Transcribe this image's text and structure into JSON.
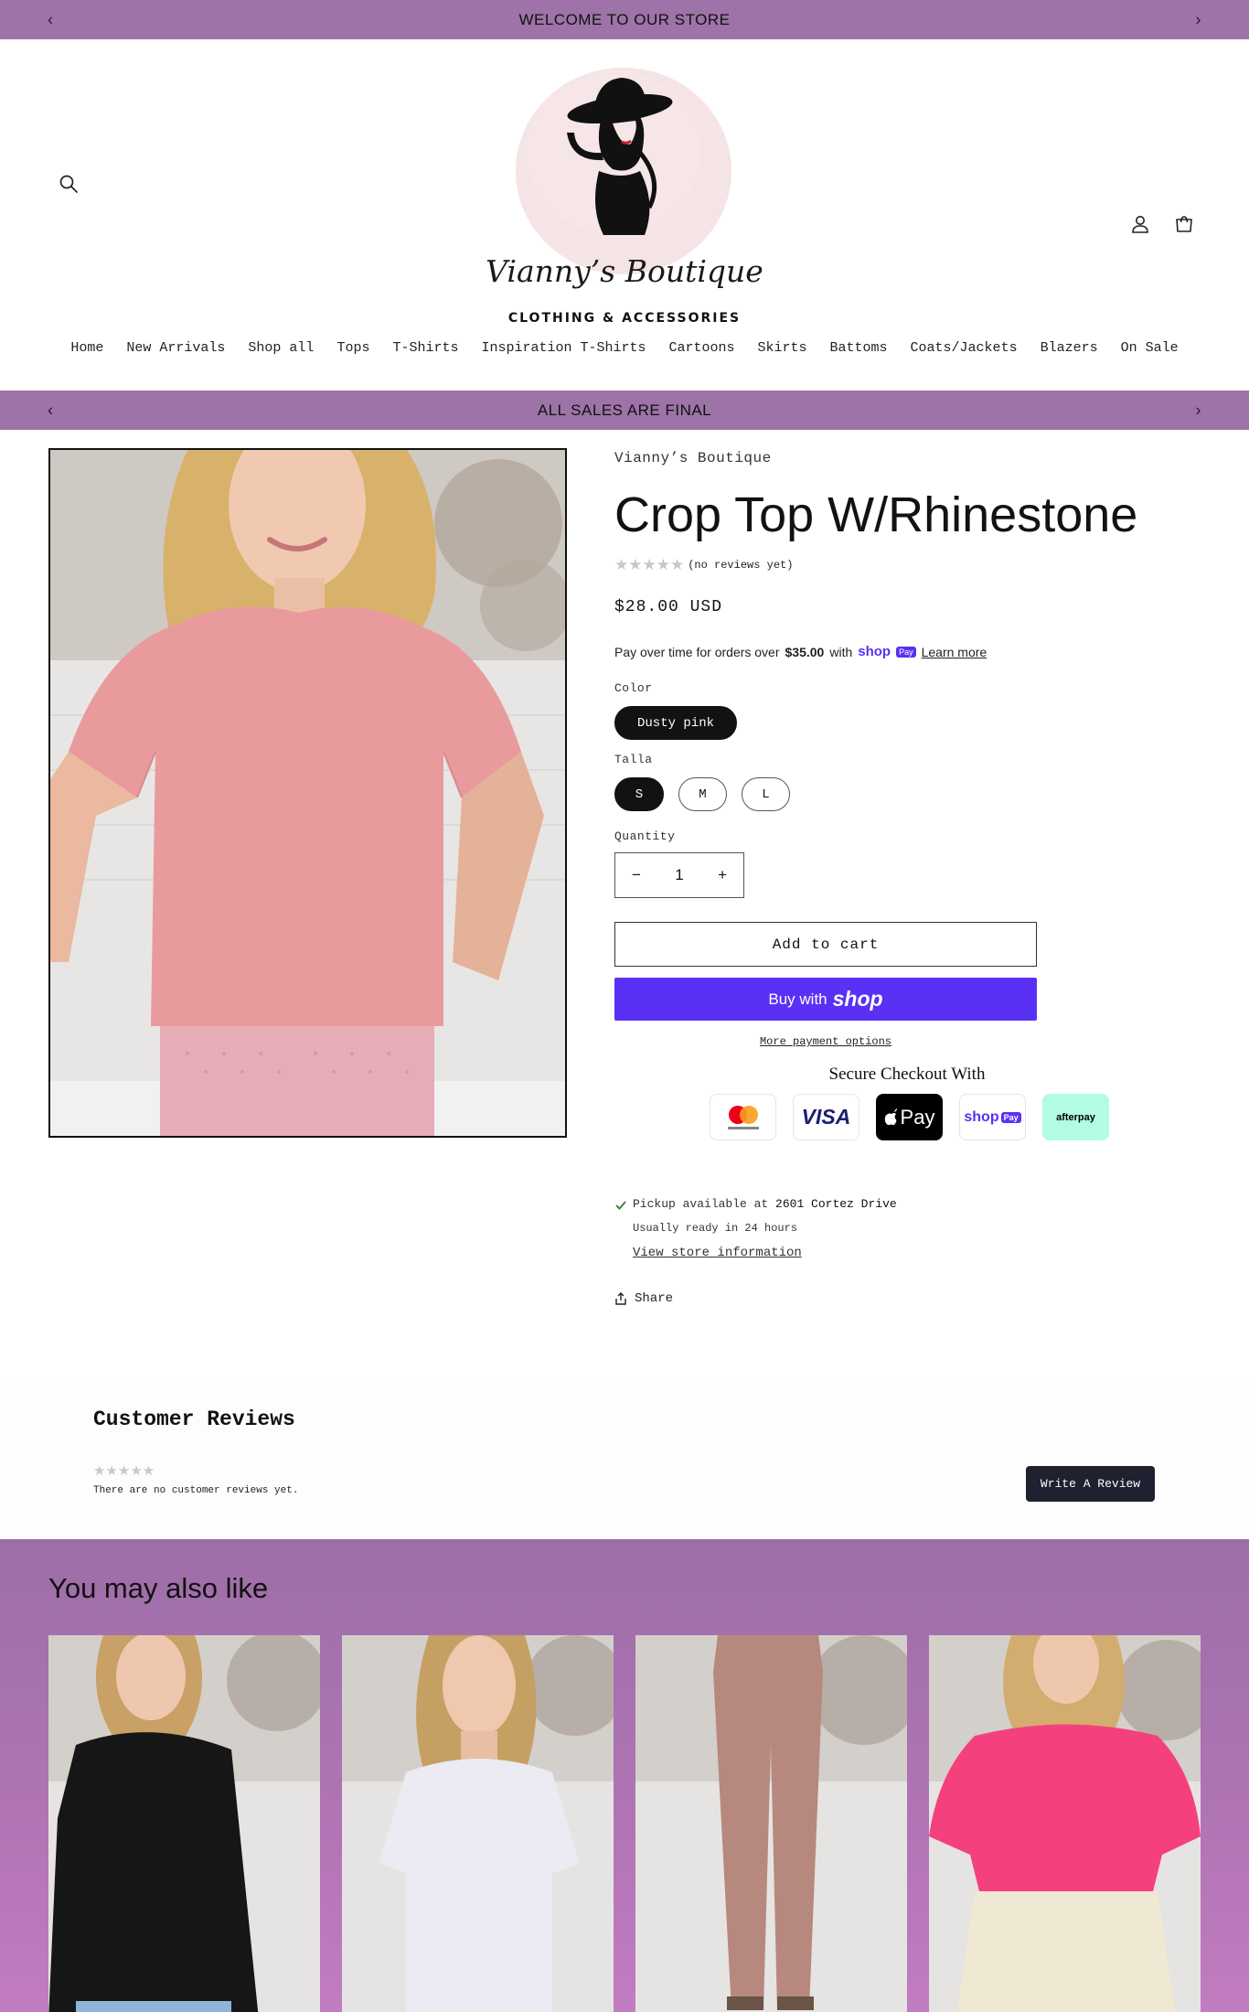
{
  "announcement_top": {
    "text": "WELCOME TO OUR STORE",
    "prev": "‹",
    "next": "›"
  },
  "announcement_second": {
    "text": "ALL SALES ARE FINAL",
    "prev": "‹",
    "next": "›"
  },
  "header": {
    "logo_title": "Vianny’s Boutique",
    "logo_subtitle": "CLOTHING & ACCESSORIES"
  },
  "nav": {
    "items": [
      "Home",
      "New Arrivals",
      "Shop all",
      "Tops",
      "T-Shirts",
      "Inspiration T-Shirts",
      "Cartoons",
      "Skirts",
      "Battoms",
      "Coats/Jackets",
      "Blazers",
      "On Sale"
    ]
  },
  "product": {
    "vendor": "Vianny’s Boutique",
    "title": "Crop Top W/Rhinestone",
    "stars": "★★★★★",
    "rating_text": "(no reviews yet)",
    "price": "$28.00 USD",
    "installments_text": "Pay over time for orders over",
    "installments_amount": "$35.00",
    "installments_with": "with",
    "installments_shop": "shop",
    "installments_pay": "Pay",
    "learn_more": "Learn more",
    "color_label": "Color",
    "color_value": "Dusty pink",
    "size_label": "Talla",
    "sizes": [
      "S",
      "M",
      "L"
    ],
    "quantity_label": "Quantity",
    "quantity_value": "1",
    "minus": "−",
    "plus": "+",
    "add_to_cart": "Add to cart",
    "buy_with": "Buy with",
    "buy_shop": "shop",
    "more_payment": "More payment options",
    "secure_checkout": "Secure Checkout With",
    "payment_cards": {
      "visa": "VISA",
      "applepay": "Pay",
      "shoppay_shop": "shop",
      "shoppay_pay": "Pay",
      "afterpay": "afterpay"
    },
    "pickup_prefix": "Pickup available at",
    "pickup_location": "2601 Cortez Drive",
    "pickup_ready": "Usually ready in 24 hours",
    "view_store": "View store information",
    "share": "Share"
  },
  "reviews": {
    "title": "Customer Reviews",
    "stars": "★★★★★",
    "empty_text": "There are no customer reviews yet.",
    "write_button": "Write A Review"
  },
  "related": {
    "title": "You may also like"
  },
  "colors": {
    "announcement_bg": "#9d73a8",
    "shop_pay_purple": "#5a31f4",
    "selected_pill": "#121212",
    "review_button": "#1f2030"
  }
}
